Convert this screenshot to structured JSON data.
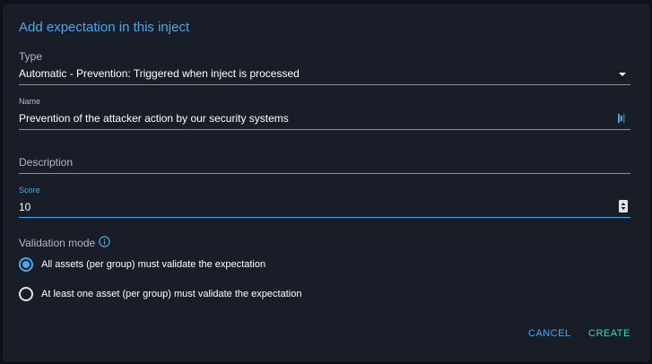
{
  "dialog": {
    "title": "Add expectation in this inject",
    "type_field": {
      "label": "Type",
      "value": "Automatic - Prevention: Triggered when inject is processed"
    },
    "name_field": {
      "label": "Name",
      "value": "Prevention of the attacker action by our security systems"
    },
    "description_field": {
      "label": "Description",
      "value": ""
    },
    "score_field": {
      "label": "Score",
      "value": "10"
    },
    "validation_mode": {
      "label": "Validation mode",
      "options": [
        {
          "label": "All assets (per group) must validate the expectation",
          "checked": true
        },
        {
          "label": "At least one asset (per group) must validate the expectation",
          "checked": false
        }
      ]
    },
    "actions": {
      "cancel_label": "CANCEL",
      "create_label": "CREATE"
    }
  },
  "colors": {
    "dialog_bg": "#181d27",
    "accent": "#4ba8e6",
    "create": "#4cd0b0",
    "text": "#ffffff",
    "muted": "#b4b8c0"
  }
}
